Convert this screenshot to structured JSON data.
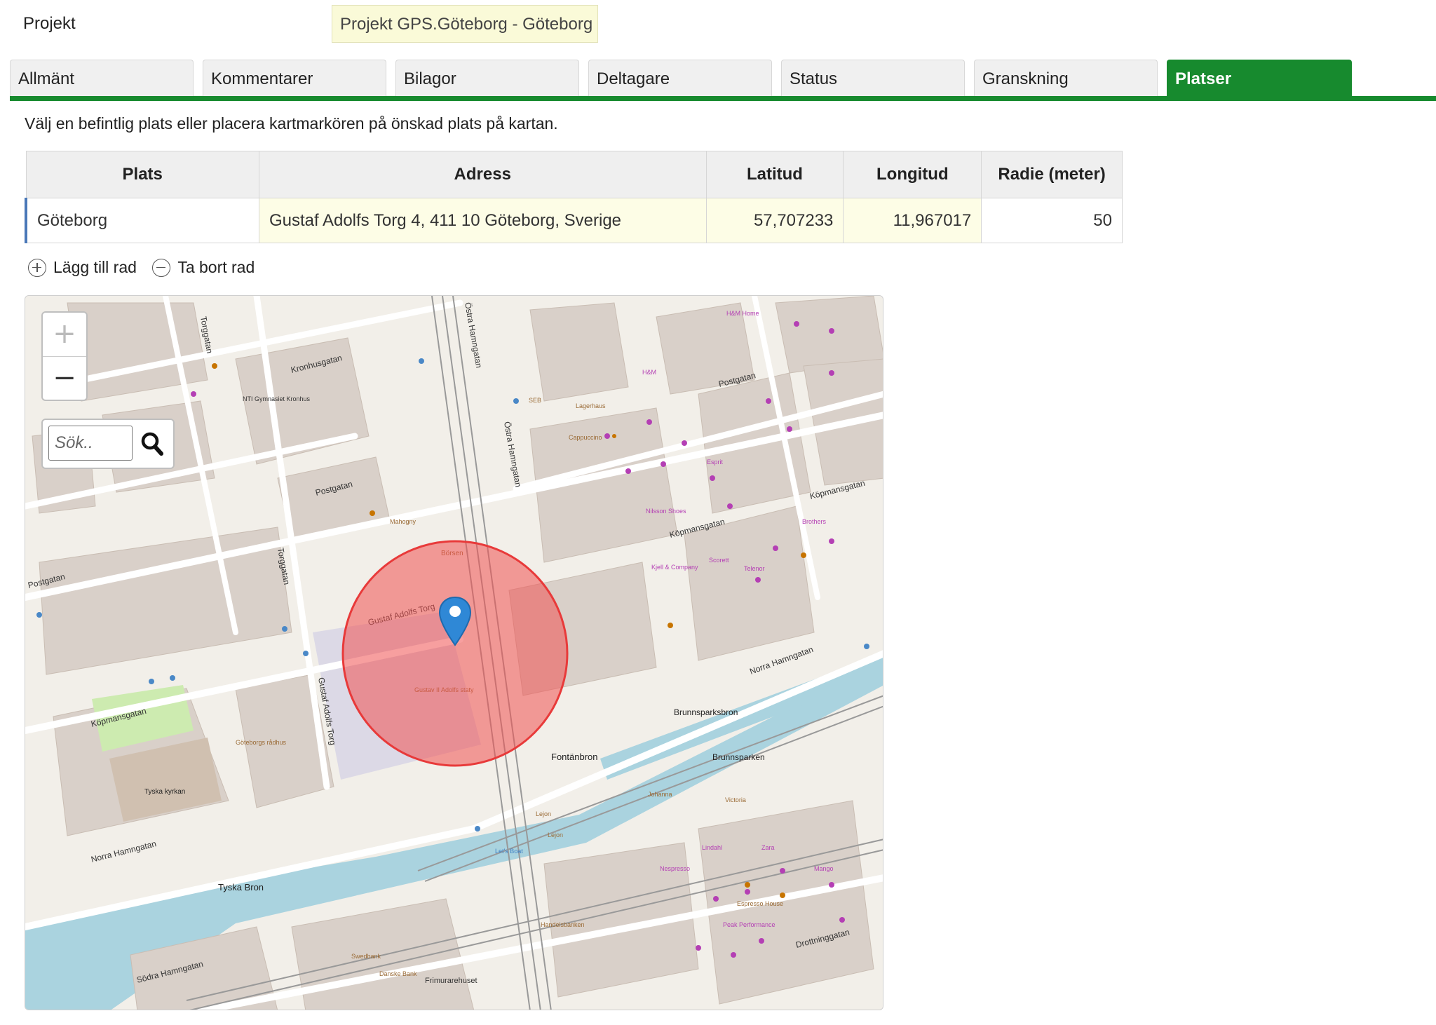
{
  "project": {
    "label": "Projekt",
    "value": "Projekt GPS.Göteborg - Göteborg"
  },
  "tabs": [
    {
      "label": "Allmänt",
      "active": false
    },
    {
      "label": "Kommentarer",
      "active": false
    },
    {
      "label": "Bilagor",
      "active": false
    },
    {
      "label": "Deltagare",
      "active": false
    },
    {
      "label": "Status",
      "active": false
    },
    {
      "label": "Granskning",
      "active": false
    },
    {
      "label": "Platser",
      "active": true
    }
  ],
  "instruction": "Välj en befintlig plats eller placera kartmarkören på önskad plats på kartan.",
  "table": {
    "headers": [
      "Plats",
      "Adress",
      "Latitud",
      "Longitud",
      "Radie (meter)"
    ],
    "rows": [
      {
        "plats": "Göteborg",
        "adress": "Gustaf Adolfs Torg 4, 411 10 Göteborg, Sverige",
        "latitud": "57,707233",
        "longitud": "11,967017",
        "radie": "50"
      }
    ]
  },
  "actions": {
    "add_row": "Lägg till rad",
    "remove_row": "Ta bort rad"
  },
  "map": {
    "zoom_in": "+",
    "zoom_out": "−",
    "search_placeholder": "Sök..",
    "labels": {
      "kronhusgatan": "Kronhusgatan",
      "postgatan": "Postgatan",
      "postgatan_w": "Postgatan",
      "postgatan_e": "Postgatan",
      "kopmansgatan_w": "Köpmansgatan",
      "kopmansgatan_m": "Köpmansgatan",
      "kopmansgatan_e": "Köpmansgatan",
      "torggatan": "Torggatan",
      "gustaf_adolfs_torg": "Gustaf Adolfs Torg",
      "gustaf_adolfs_torg_v": "Gustaf Adolfs Torg",
      "ostra_hamngatan": "Östra Hamngatan",
      "norra_hamngatan_w": "Norra Hamngatan",
      "norra_hamngatan_e": "Norra Hamngatan",
      "sodra_hamngatan": "Södra Hamngatan",
      "drottninggatan": "Drottninggatan",
      "fontanbron": "Fontänbron",
      "brunnsparksbron": "Brunnsparksbron",
      "brunnsparken": "Brunnsparken",
      "tyska_bron": "Tyska Bron",
      "tyska_kyrkan": "Tyska kyrkan",
      "frimurarehuset": "Frimurarehuset",
      "borsen": "Börsen",
      "gustav_staty": "Gustav II Adolfs staty",
      "goteborgs_radhus": "Göteborgs rådhus",
      "handelsbanken": "Handelsbanken",
      "danske_bank": "Danske Bank",
      "swedbank": "Swedbank",
      "lets_boat": "Let's Boat",
      "hm": "H&M",
      "hm_home": "H&M Home",
      "zara": "Zara",
      "mango": "Mango",
      "lejon": "Lejon",
      "nk": "NTI Gymnasiet Kronhus",
      "mahogny": "Mahogny",
      "lagerhaus": "Lagerhaus",
      "cappuccino": "Cappuccino",
      "seb": "SEB",
      "esprit": "Esprit",
      "nilsson_shoes": "Nilsson Shoes",
      "scorett": "Scorett",
      "telenor": "Telenor",
      "kjell": "Kjell & Company",
      "brothers": "Brothers",
      "lindahl": "Lindahl",
      "nespresso": "Nespresso",
      "espresso_house": "Espresso House",
      "peak_performance": "Peak Performance",
      "victoria": "Victoria",
      "johanna": "Johanna"
    }
  }
}
